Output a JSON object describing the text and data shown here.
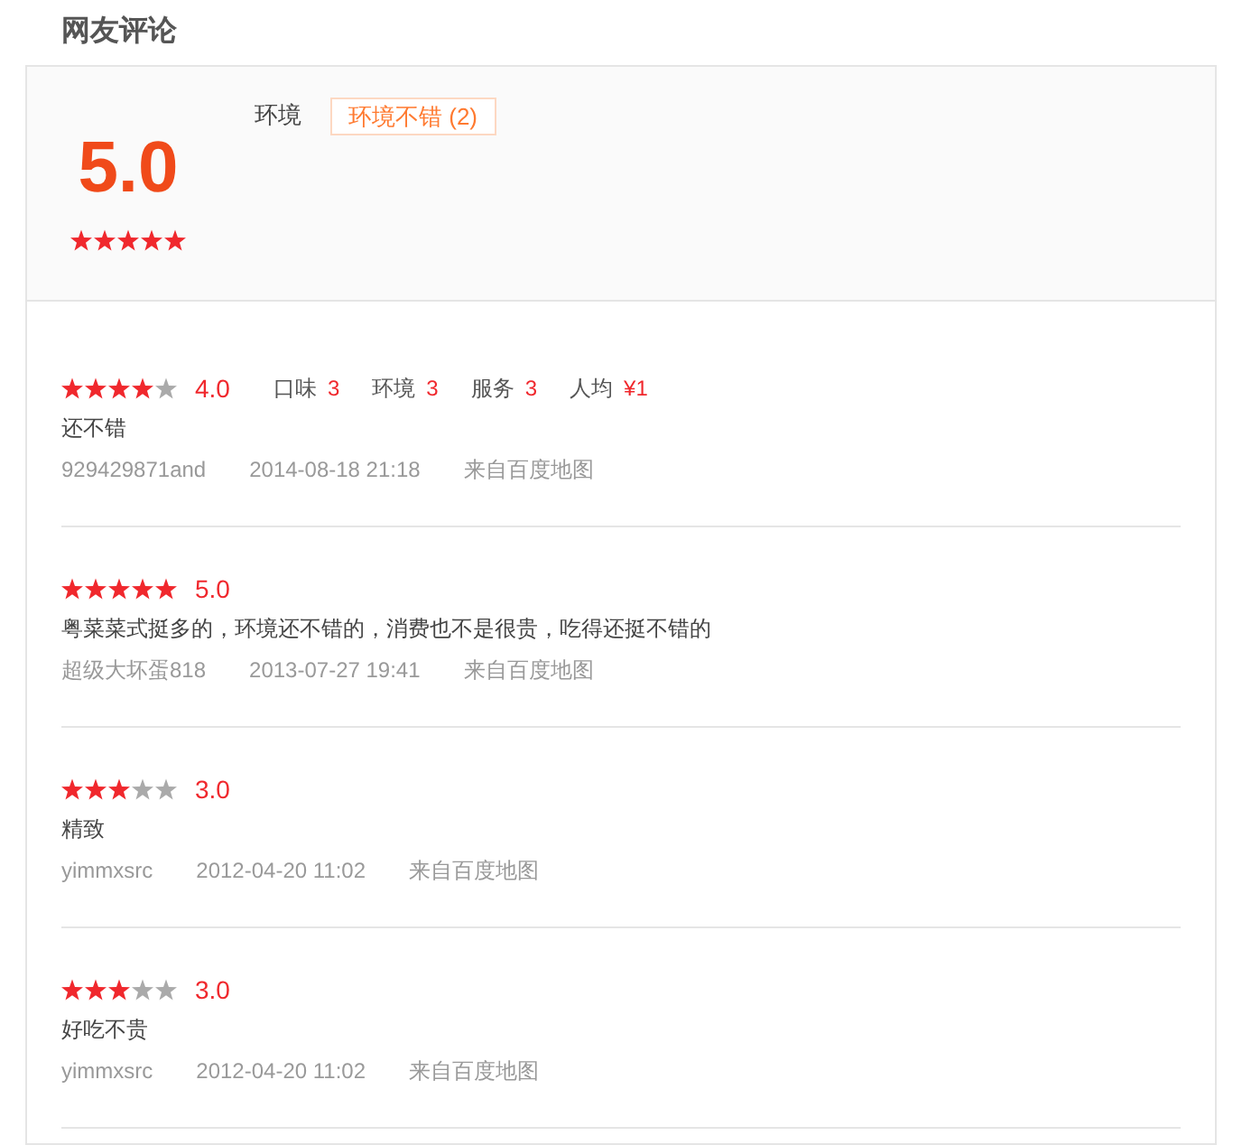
{
  "title": "网友评论",
  "summary": {
    "score": "5.0",
    "stars": 5,
    "category": "环境",
    "tags": [
      {
        "label": "环境不错 (2)"
      }
    ]
  },
  "reviews": [
    {
      "stars": 4,
      "score": "4.0",
      "sub_ratings": [
        {
          "label": "口味",
          "value": "3"
        },
        {
          "label": "环境",
          "value": "3"
        },
        {
          "label": "服务",
          "value": "3"
        },
        {
          "label": "人均",
          "value": "¥1"
        }
      ],
      "text": "还不错",
      "user": "929429871and",
      "time": "2014-08-18 21:18",
      "source": "来自百度地图"
    },
    {
      "stars": 5,
      "score": "5.0",
      "text": "粤菜菜式挺多的，环境还不错的，消费也不是很贵，吃得还挺不错的",
      "user": "超级大坏蛋818",
      "time": "2013-07-27 19:41",
      "source": "来自百度地图"
    },
    {
      "stars": 3,
      "score": "3.0",
      "text": "精致",
      "user": "yimmxsrc",
      "time": "2012-04-20 11:02",
      "source": "来自百度地图"
    },
    {
      "stars": 3,
      "score": "3.0",
      "text": "好吃不贵",
      "user": "yimmxsrc",
      "time": "2012-04-20 11:02",
      "source": "来自百度地图"
    }
  ]
}
